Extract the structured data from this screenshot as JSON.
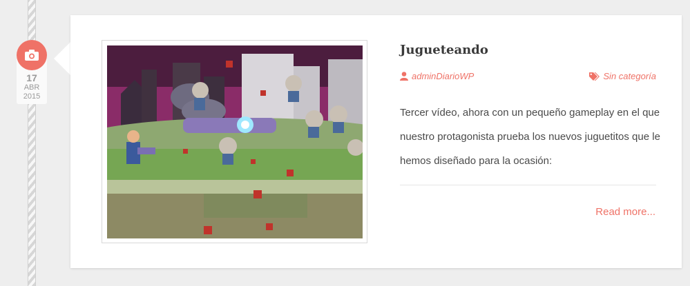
{
  "date": {
    "day": "17",
    "month": "ABR",
    "year": "2015"
  },
  "post": {
    "title": "Jugueteando",
    "author": "adminDiarioWP",
    "category": "Sin categoría",
    "excerpt": "Tercer vídeo, ahora con un pequeño gameplay en el que nuestro protagonista prueba los nuevos juguetitos que le hemos diseñado para la ocasión:",
    "read_more": "Read more..."
  },
  "icons": {
    "badge": "camera-icon",
    "author": "user-icon",
    "category": "tags-icon"
  },
  "colors": {
    "accent": "#ef7267",
    "text": "#4a4a4a",
    "title": "#3a3a3a"
  }
}
